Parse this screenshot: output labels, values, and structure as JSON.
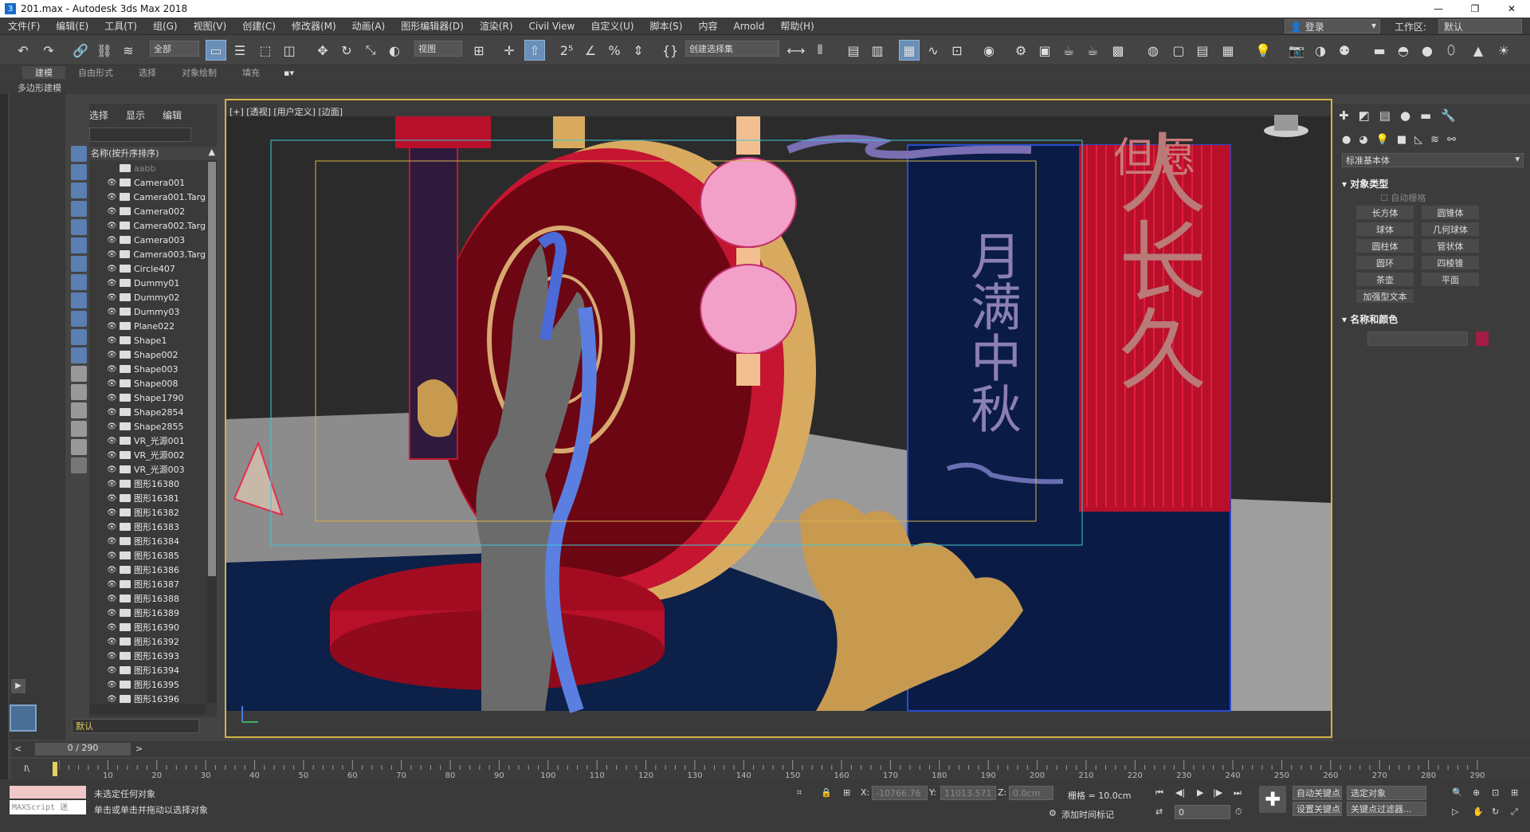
{
  "title": "201.max - Autodesk 3ds Max 2018",
  "window_controls": [
    "—",
    "❐",
    "✕"
  ],
  "menu": [
    "文件(F)",
    "编辑(E)",
    "工具(T)",
    "组(G)",
    "视图(V)",
    "创建(C)",
    "修改器(M)",
    "动画(A)",
    "图形编辑器(D)",
    "渲染(R)",
    "Civil View",
    "自定义(U)",
    "脚本(S)",
    "内容",
    "Arnold",
    "帮助(H)"
  ],
  "login": "登录",
  "workspace_label": "工作区:",
  "workspace_value": "默认",
  "toolbar": {
    "filter_select": "全部",
    "view_select": "视图",
    "selection_set": "创建选择集"
  },
  "ribbon_tabs": [
    "建模",
    "自由形式",
    "选择",
    "对象绘制",
    "填充"
  ],
  "ribbon_sub": "多边形建模",
  "scene_explorer": {
    "tabs": [
      "选择",
      "显示",
      "编辑"
    ],
    "header": "名称(按升序排序)",
    "items": [
      "aabb",
      "Camera001",
      "Camera001.Targ",
      "Camera002",
      "Camera002.Targ",
      "Camera003",
      "Camera003.Targ",
      "Circle407",
      "Dummy01",
      "Dummy02",
      "Dummy03",
      "Plane022",
      "Shape1",
      "Shape002",
      "Shape003",
      "Shape008",
      "Shape1790",
      "Shape2854",
      "Shape2855",
      "VR_光源001",
      "VR_光源002",
      "VR_光源003",
      "图形16380",
      "图形16381",
      "图形16382",
      "图形16383",
      "图形16384",
      "图形16385",
      "图形16386",
      "图形16387",
      "图形16388",
      "图形16389",
      "图形16390",
      "图形16392",
      "图形16393",
      "图形16394",
      "图形16395",
      "图形16396"
    ],
    "layer": "默认"
  },
  "viewport": {
    "label": "[+] [透视] [用户定义] [边面]",
    "texts": {
      "big_vertical": "人长久",
      "top_partial": "但愿",
      "panel_text": "月满中秋"
    },
    "colors": {
      "bg_dark": "#2b2b2b",
      "floor_blue": "#0c2048",
      "red": "#b8102a",
      "gold": "#d8aa60",
      "pink": "#f2a0c8",
      "navy": "#0a1c46",
      "grey_wall": "#9a9a9a"
    }
  },
  "command_panel": {
    "dropdown": "标准基本体",
    "rollout_object_type": "对象类型",
    "autogrid": "自动栅格",
    "buttons": [
      "长方体",
      "圆锥体",
      "球体",
      "几何球体",
      "圆柱体",
      "管状体",
      "圆环",
      "四棱锥",
      "茶壶",
      "平面",
      "加强型文本"
    ],
    "rollout_name_color": "名称和颜色",
    "color": "#a31c44"
  },
  "timeline": {
    "frame": "0 / 290",
    "ticks": [
      "10",
      "20",
      "30",
      "40",
      "50",
      "60",
      "70",
      "80",
      "90",
      "100",
      "110",
      "120",
      "130",
      "140",
      "150",
      "160",
      "170",
      "180",
      "190",
      "200",
      "210",
      "220",
      "230",
      "240",
      "250",
      "260",
      "270",
      "280",
      "290"
    ]
  },
  "status": {
    "script": "MAXScript 迷",
    "msg1": "未选定任何对象",
    "msg2": "单击或单击并拖动以选择对象",
    "x_label": "X:",
    "x": "-10766.76",
    "y_label": "Y:",
    "y": "11013.571",
    "z_label": "Z:",
    "z": "0.0cm",
    "grid": "栅格 = 10.0cm",
    "add_time_tag": "添加时间标记",
    "auto_key": "自动关键点",
    "set_key": "设置关键点",
    "key_selected": "选定对象",
    "key_filters": "关键点过滤器...",
    "frame_field": "0"
  }
}
